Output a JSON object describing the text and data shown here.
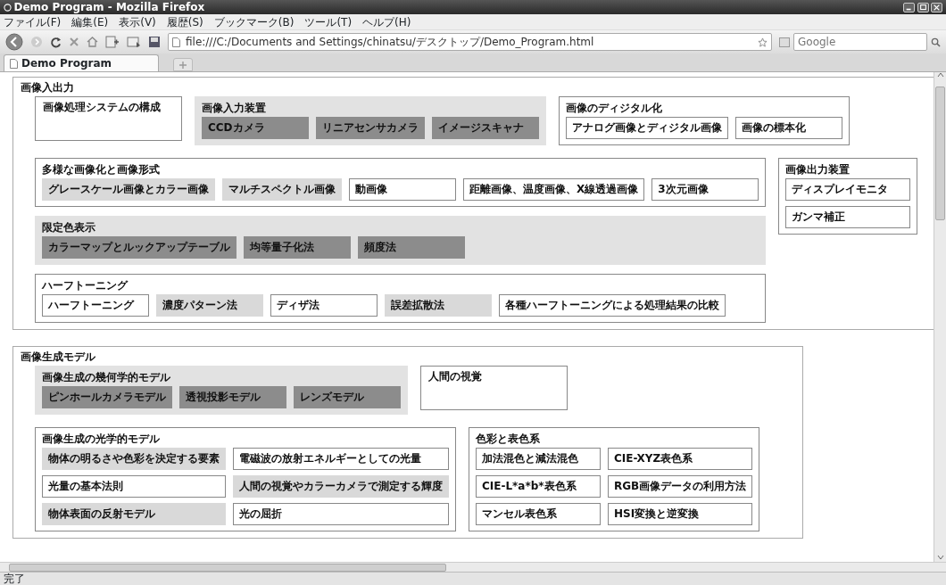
{
  "window": {
    "title": "Demo Program - Mozilla Firefox"
  },
  "menu": [
    "ファイル(F)",
    "編集(E)",
    "表示(V)",
    "履歴(S)",
    "ブックマーク(B)",
    "ツール(T)",
    "ヘルプ(H)"
  ],
  "address": {
    "value": "file:///C:/Documents and Settings/chinatsu/デスクトップ/Demo_Program.html"
  },
  "search": {
    "placeholder": "Google"
  },
  "tabs": [
    {
      "label": "Demo Program",
      "selected": true
    }
  ],
  "sections": [
    {
      "title": "画像入出力",
      "rows": [
        {
          "columns": [
            {
              "blocks": [
                {
                  "kind": "box",
                  "title": "画像処理システムの構成"
                }
              ]
            },
            {
              "blocks": [
                {
                  "kind": "row-group",
                  "color": "#e2e2e2",
                  "title": "画像入力装置",
                  "items": [
                    {
                      "label": "CCDカメラ",
                      "color": "#8c8c8c"
                    },
                    {
                      "label": "リニアセンサカメラ",
                      "color": "#8c8c8c"
                    },
                    {
                      "label": "イメージスキャナ",
                      "color": "#8c8c8c"
                    }
                  ]
                }
              ]
            },
            {
              "blocks": [
                {
                  "kind": "row-group",
                  "color": "#ffffff",
                  "title": "画像のディジタル化",
                  "items": [
                    {
                      "label": "アナログ画像とディジタル画像",
                      "color": "#ffffff"
                    },
                    {
                      "label": "画像の標本化",
                      "color": "#ffffff"
                    }
                  ]
                }
              ]
            }
          ]
        },
        {
          "columns": [
            {
              "blocks": [
                {
                  "kind": "row-group",
                  "color": "#ffffff",
                  "title": "多様な画像化と画像形式",
                  "items": [
                    {
                      "label": "グレースケール画像とカラー画像",
                      "color": "#d9d9d9"
                    },
                    {
                      "label": "マルチスペクトル画像",
                      "color": "#d9d9d9"
                    },
                    {
                      "label": "動画像",
                      "color": "#ffffff"
                    },
                    {
                      "label": "距離画像、温度画像、X線透過画像",
                      "color": "#ffffff"
                    },
                    {
                      "label": "3次元画像",
                      "color": "#ffffff"
                    }
                  ]
                },
                {
                  "kind": "row-group",
                  "color": "#e2e2e2",
                  "title": "限定色表示",
                  "items": [
                    {
                      "label": "カラーマップとルックアップテーブル",
                      "color": "#8c8c8c"
                    },
                    {
                      "label": "均等量子化法",
                      "color": "#8c8c8c"
                    },
                    {
                      "label": "頻度法",
                      "color": "#8c8c8c"
                    }
                  ]
                },
                {
                  "kind": "row-group",
                  "color": "#ffffff",
                  "title": "ハーフトーニング",
                  "items": [
                    {
                      "label": "ハーフトーニング",
                      "color": "#ffffff"
                    },
                    {
                      "label": "濃度パターン法",
                      "color": "#d9d9d9"
                    },
                    {
                      "label": "ディザ法",
                      "color": "#ffffff"
                    },
                    {
                      "label": "誤差拡散法",
                      "color": "#d9d9d9"
                    },
                    {
                      "label": "各種ハーフトーニングによる処理結果の比較",
                      "color": "#ffffff"
                    }
                  ]
                }
              ]
            },
            {
              "blocks": [
                {
                  "kind": "stack-group",
                  "color": "#ffffff",
                  "title": "画像出力装置",
                  "items": [
                    {
                      "label": "ディスプレイモニタ",
                      "color": "#ffffff"
                    },
                    {
                      "label": "ガンマ補正",
                      "color": "#ffffff"
                    }
                  ]
                }
              ]
            }
          ]
        }
      ]
    },
    {
      "title": "画像生成モデル",
      "rows": [
        {
          "columns": [
            {
              "blocks": [
                {
                  "kind": "row-group",
                  "color": "#e2e2e2",
                  "title": "画像生成の幾何学的モデル",
                  "items": [
                    {
                      "label": "ピンホールカメラモデル",
                      "color": "#8c8c8c"
                    },
                    {
                      "label": "透視投影モデル",
                      "color": "#8c8c8c"
                    },
                    {
                      "label": "レンズモデル",
                      "color": "#8c8c8c"
                    }
                  ]
                }
              ]
            },
            {
              "blocks": [
                {
                  "kind": "box",
                  "title": "人間の視覚"
                }
              ]
            }
          ]
        },
        {
          "columns": [
            {
              "blocks": [
                {
                  "kind": "grid-group",
                  "color": "#ffffff",
                  "title": "画像生成の光学的モデル",
                  "items": [
                    {
                      "label": "物体の明るさや色彩を決定する要素",
                      "color": "#d9d9d9"
                    },
                    {
                      "label": "電磁波の放射エネルギーとしての光量",
                      "color": "#ffffff"
                    },
                    {
                      "label": "光量の基本法則",
                      "color": "#ffffff"
                    },
                    {
                      "label": "人間の視覚やカラーカメラで測定する輝度",
                      "color": "#d9d9d9"
                    },
                    {
                      "label": "物体表面の反射モデル",
                      "color": "#d9d9d9"
                    },
                    {
                      "label": "光の屈折",
                      "color": "#ffffff"
                    }
                  ]
                }
              ]
            },
            {
              "blocks": [
                {
                  "kind": "grid-group",
                  "color": "#ffffff",
                  "title": "色彩と表色系",
                  "items": [
                    {
                      "label": "加法混色と減法混色",
                      "color": "#ffffff"
                    },
                    {
                      "label": "CIE-XYZ表色系",
                      "color": "#ffffff"
                    },
                    {
                      "label": "CIE-L*a*b*表色系",
                      "color": "#ffffff"
                    },
                    {
                      "label": "RGB画像データの利用方法",
                      "color": "#ffffff"
                    },
                    {
                      "label": "マンセル表色系",
                      "color": "#ffffff"
                    },
                    {
                      "label": "HSI変換と逆変換",
                      "color": "#ffffff"
                    }
                  ]
                }
              ]
            }
          ]
        }
      ]
    }
  ],
  "status_bar": "完了"
}
